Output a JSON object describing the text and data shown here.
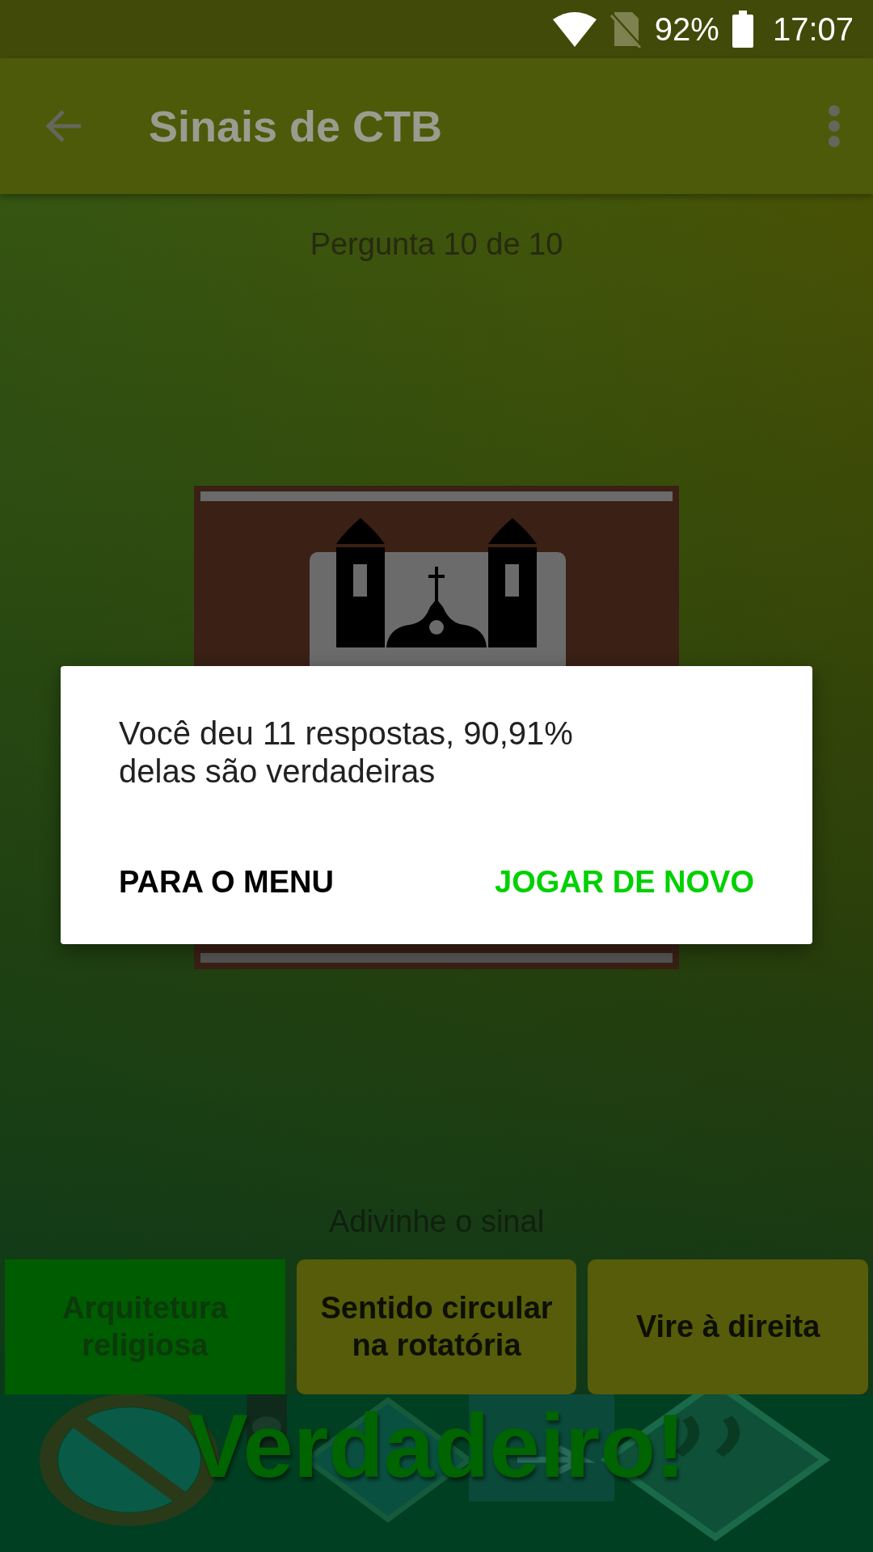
{
  "status_bar": {
    "battery": "92%",
    "time": "17:07"
  },
  "app_bar": {
    "title": "Sinais de CTB"
  },
  "question": {
    "counter": "Pergunta 10 de 10",
    "prompt": "Adivinhe o sinal"
  },
  "answers": [
    {
      "label": "Arquitetura religiosa",
      "correct": true
    },
    {
      "label": "Sentido circular na rotatória",
      "correct": false
    },
    {
      "label": "Vire à direita",
      "correct": false
    }
  ],
  "result": "Verdadeiro!",
  "dialog": {
    "message": "Você deu 11 respostas, 90,91% delas são verdadeiras",
    "buttons": [
      {
        "label": "PARA O MENU",
        "kind": "neutral"
      },
      {
        "label": "JOGAR DE NOVO",
        "kind": "primary"
      }
    ]
  }
}
